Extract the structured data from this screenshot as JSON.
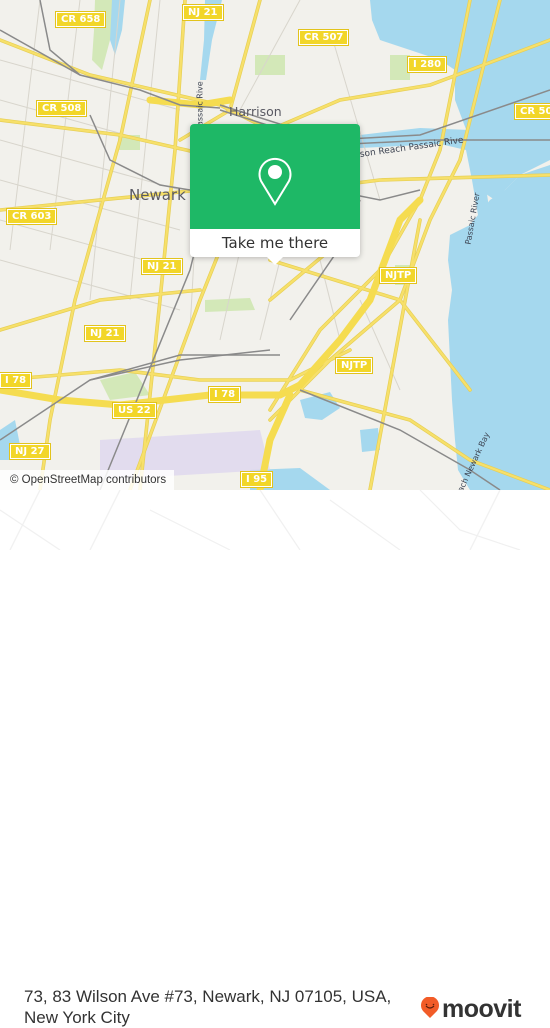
{
  "map": {
    "colors": {
      "land": "#f2f1ec",
      "water": "#a5d8ee",
      "park": "#d3e8b8",
      "road": "#f7e06a",
      "road_casing": "#e6cf55",
      "rail": "#8a8a8a",
      "airport": "#dcd3f0",
      "shield_bg": "#f2d629"
    },
    "place_labels": {
      "harrison": "Harrison",
      "newark": "Newark"
    },
    "water_labels": {
      "passaic_reach": "son Reach Passaic Rive",
      "passaic_west": "Passaic Rive",
      "passaic_east": "Passaic River",
      "newark_bay": "ach Newark Bay"
    },
    "route_shields": [
      {
        "id": "cr658",
        "label": "CR 658"
      },
      {
        "id": "nj21-top",
        "label": "NJ 21"
      },
      {
        "id": "cr507",
        "label": "CR 507"
      },
      {
        "id": "i280",
        "label": "I 280"
      },
      {
        "id": "cr508-left",
        "label": "CR 508"
      },
      {
        "id": "cr508-right",
        "label": "CR 50"
      },
      {
        "id": "cr603",
        "label": "CR 603"
      },
      {
        "id": "nj21-mid",
        "label": "NJ 21"
      },
      {
        "id": "nj21-low",
        "label": "NJ 21"
      },
      {
        "id": "njtp-top",
        "label": "NJTP"
      },
      {
        "id": "njtp-low",
        "label": "NJTP"
      },
      {
        "id": "i78-left",
        "label": "I 78"
      },
      {
        "id": "i78-mid",
        "label": "I 78"
      },
      {
        "id": "us22",
        "label": "US 22"
      },
      {
        "id": "nj27",
        "label": "NJ 27"
      },
      {
        "id": "i95",
        "label": "I 95"
      }
    ]
  },
  "popup": {
    "icon": "map-pin-icon",
    "accent": "#1eb866",
    "button_label": "Take me there"
  },
  "attribution": "© OpenStreetMap contributors",
  "footer": {
    "address": "73, 83 Wilson Ave #73, Newark, NJ 07105, USA, New York City",
    "brand": {
      "name": "moovit",
      "icon": "moovit-logo-icon",
      "accent": "#f25c28"
    }
  }
}
